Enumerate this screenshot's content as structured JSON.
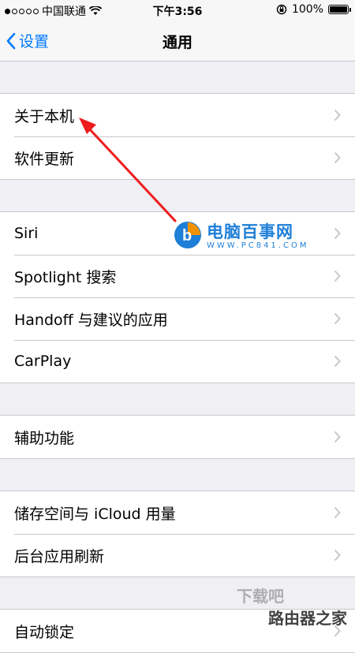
{
  "status_bar": {
    "carrier": "中国联通",
    "time": "下午3:56",
    "battery_pct": "100%",
    "signal_bars_filled": 1,
    "signal_bars_total": 5
  },
  "nav": {
    "back_label": "设置",
    "title": "通用"
  },
  "groups": [
    {
      "items": [
        {
          "label": "关于本机"
        },
        {
          "label": "软件更新"
        }
      ]
    },
    {
      "items": [
        {
          "label": "Siri"
        },
        {
          "label": "Spotlight 搜索"
        },
        {
          "label": "Handoff 与建议的应用"
        },
        {
          "label": "CarPlay"
        }
      ]
    },
    {
      "items": [
        {
          "label": "辅助功能"
        }
      ]
    },
    {
      "items": [
        {
          "label": "储存空间与 iCloud 用量"
        },
        {
          "label": "后台应用刷新"
        }
      ]
    },
    {
      "items": [
        {
          "label": "自动锁定"
        }
      ]
    }
  ],
  "watermark": {
    "title": "电脑百事网",
    "url": "WWW.PC841.COM"
  },
  "corner_watermark": {
    "line1": "下载吧",
    "line2": "路由器之家"
  },
  "colors": {
    "accent": "#007aff",
    "annotation_arrow": "#ee1c1c",
    "background": "#efeff4"
  }
}
